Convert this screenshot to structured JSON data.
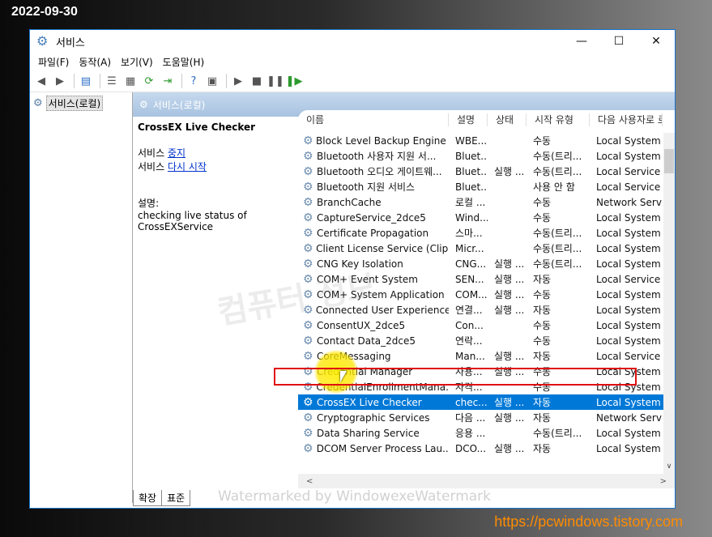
{
  "overlay": {
    "date": "2022-09-30",
    "url": "https://pcwindows.tistory.com",
    "watermark_main": "컴퓨터 정보",
    "watermark_bottom": "Watermarked by WindowexeWatermark"
  },
  "window": {
    "title": "서비스",
    "menu": [
      "파일(F)",
      "동작(A)",
      "보기(V)",
      "도움말(H)"
    ]
  },
  "tree": {
    "root": "서비스(로컬)"
  },
  "pane": {
    "header": "서비스(로컬)"
  },
  "detail": {
    "service_name": "CrossEX Live Checker",
    "prefix": "서비스",
    "stop_link": "중지",
    "restart_link": "다시 시작",
    "description_label": "설명:",
    "description": "checking live status of CrossEXService"
  },
  "columns": [
    "이름",
    "설명",
    "상태",
    "시작 유형",
    "다음 사용자로 로그온"
  ],
  "services": [
    {
      "name": "Block Level Backup Engine ...",
      "desc": "WBE...",
      "status": "",
      "start": "수동",
      "logon": "Local System"
    },
    {
      "name": "Bluetooth 사용자 지원 서...",
      "desc": "Bluet...",
      "status": "",
      "start": "수동(트리...",
      "logon": "Local System"
    },
    {
      "name": "Bluetooth 오디오 게이트웨...",
      "desc": "Bluet...",
      "status": "실행 ...",
      "start": "수동(트리...",
      "logon": "Local Service"
    },
    {
      "name": "Bluetooth 지원 서비스",
      "desc": "Bluet...",
      "status": "",
      "start": "사용 안 함",
      "logon": "Local Service"
    },
    {
      "name": "BranchCache",
      "desc": "로컬 ...",
      "status": "",
      "start": "수동",
      "logon": "Network Service"
    },
    {
      "name": "CaptureService_2dce5",
      "desc": "Wind...",
      "status": "",
      "start": "수동",
      "logon": "Local System"
    },
    {
      "name": "Certificate Propagation",
      "desc": "스마...",
      "status": "",
      "start": "수동(트리...",
      "logon": "Local System"
    },
    {
      "name": "Client License Service (Clip...",
      "desc": "Micr...",
      "status": "",
      "start": "수동(트리...",
      "logon": "Local System"
    },
    {
      "name": "CNG Key Isolation",
      "desc": "CNG...",
      "status": "실행 ...",
      "start": "수동(트리...",
      "logon": "Local System"
    },
    {
      "name": "COM+ Event System",
      "desc": "SEN...",
      "status": "실행 ...",
      "start": "자동",
      "logon": "Local Service"
    },
    {
      "name": "COM+ System Application",
      "desc": "COM...",
      "status": "실행 ...",
      "start": "수동",
      "logon": "Local System"
    },
    {
      "name": "Connected User Experience...",
      "desc": "연결...",
      "status": "실행 ...",
      "start": "자동",
      "logon": "Local System"
    },
    {
      "name": "ConsentUX_2dce5",
      "desc": "Con...",
      "status": "",
      "start": "수동",
      "logon": "Local System"
    },
    {
      "name": "Contact Data_2dce5",
      "desc": "연락...",
      "status": "",
      "start": "수동",
      "logon": "Local System"
    },
    {
      "name": "CoreMessaging",
      "desc": "Man...",
      "status": "실행 ...",
      "start": "자동",
      "logon": "Local Service"
    },
    {
      "name": "Credential Manager",
      "desc": "사용...",
      "status": "실행 ...",
      "start": "수동",
      "logon": "Local System"
    },
    {
      "name": "CredentialEnrollmentMana...",
      "desc": "자격...",
      "status": "",
      "start": "수동",
      "logon": "Local System"
    },
    {
      "name": "CrossEX Live Checker",
      "desc": "chec...",
      "status": "실행 ...",
      "start": "자동",
      "logon": "Local System",
      "selected": true
    },
    {
      "name": "Cryptographic Services",
      "desc": "다음 ...",
      "status": "실행 ...",
      "start": "자동",
      "logon": "Network Service"
    },
    {
      "name": "Data Sharing Service",
      "desc": "응용 ...",
      "status": "",
      "start": "수동(트리...",
      "logon": "Local System"
    },
    {
      "name": "DCOM Server Process Lau...",
      "desc": "DCO...",
      "status": "실행 ...",
      "start": "자동",
      "logon": "Local System"
    }
  ],
  "tabs": [
    "확장",
    "표준"
  ]
}
